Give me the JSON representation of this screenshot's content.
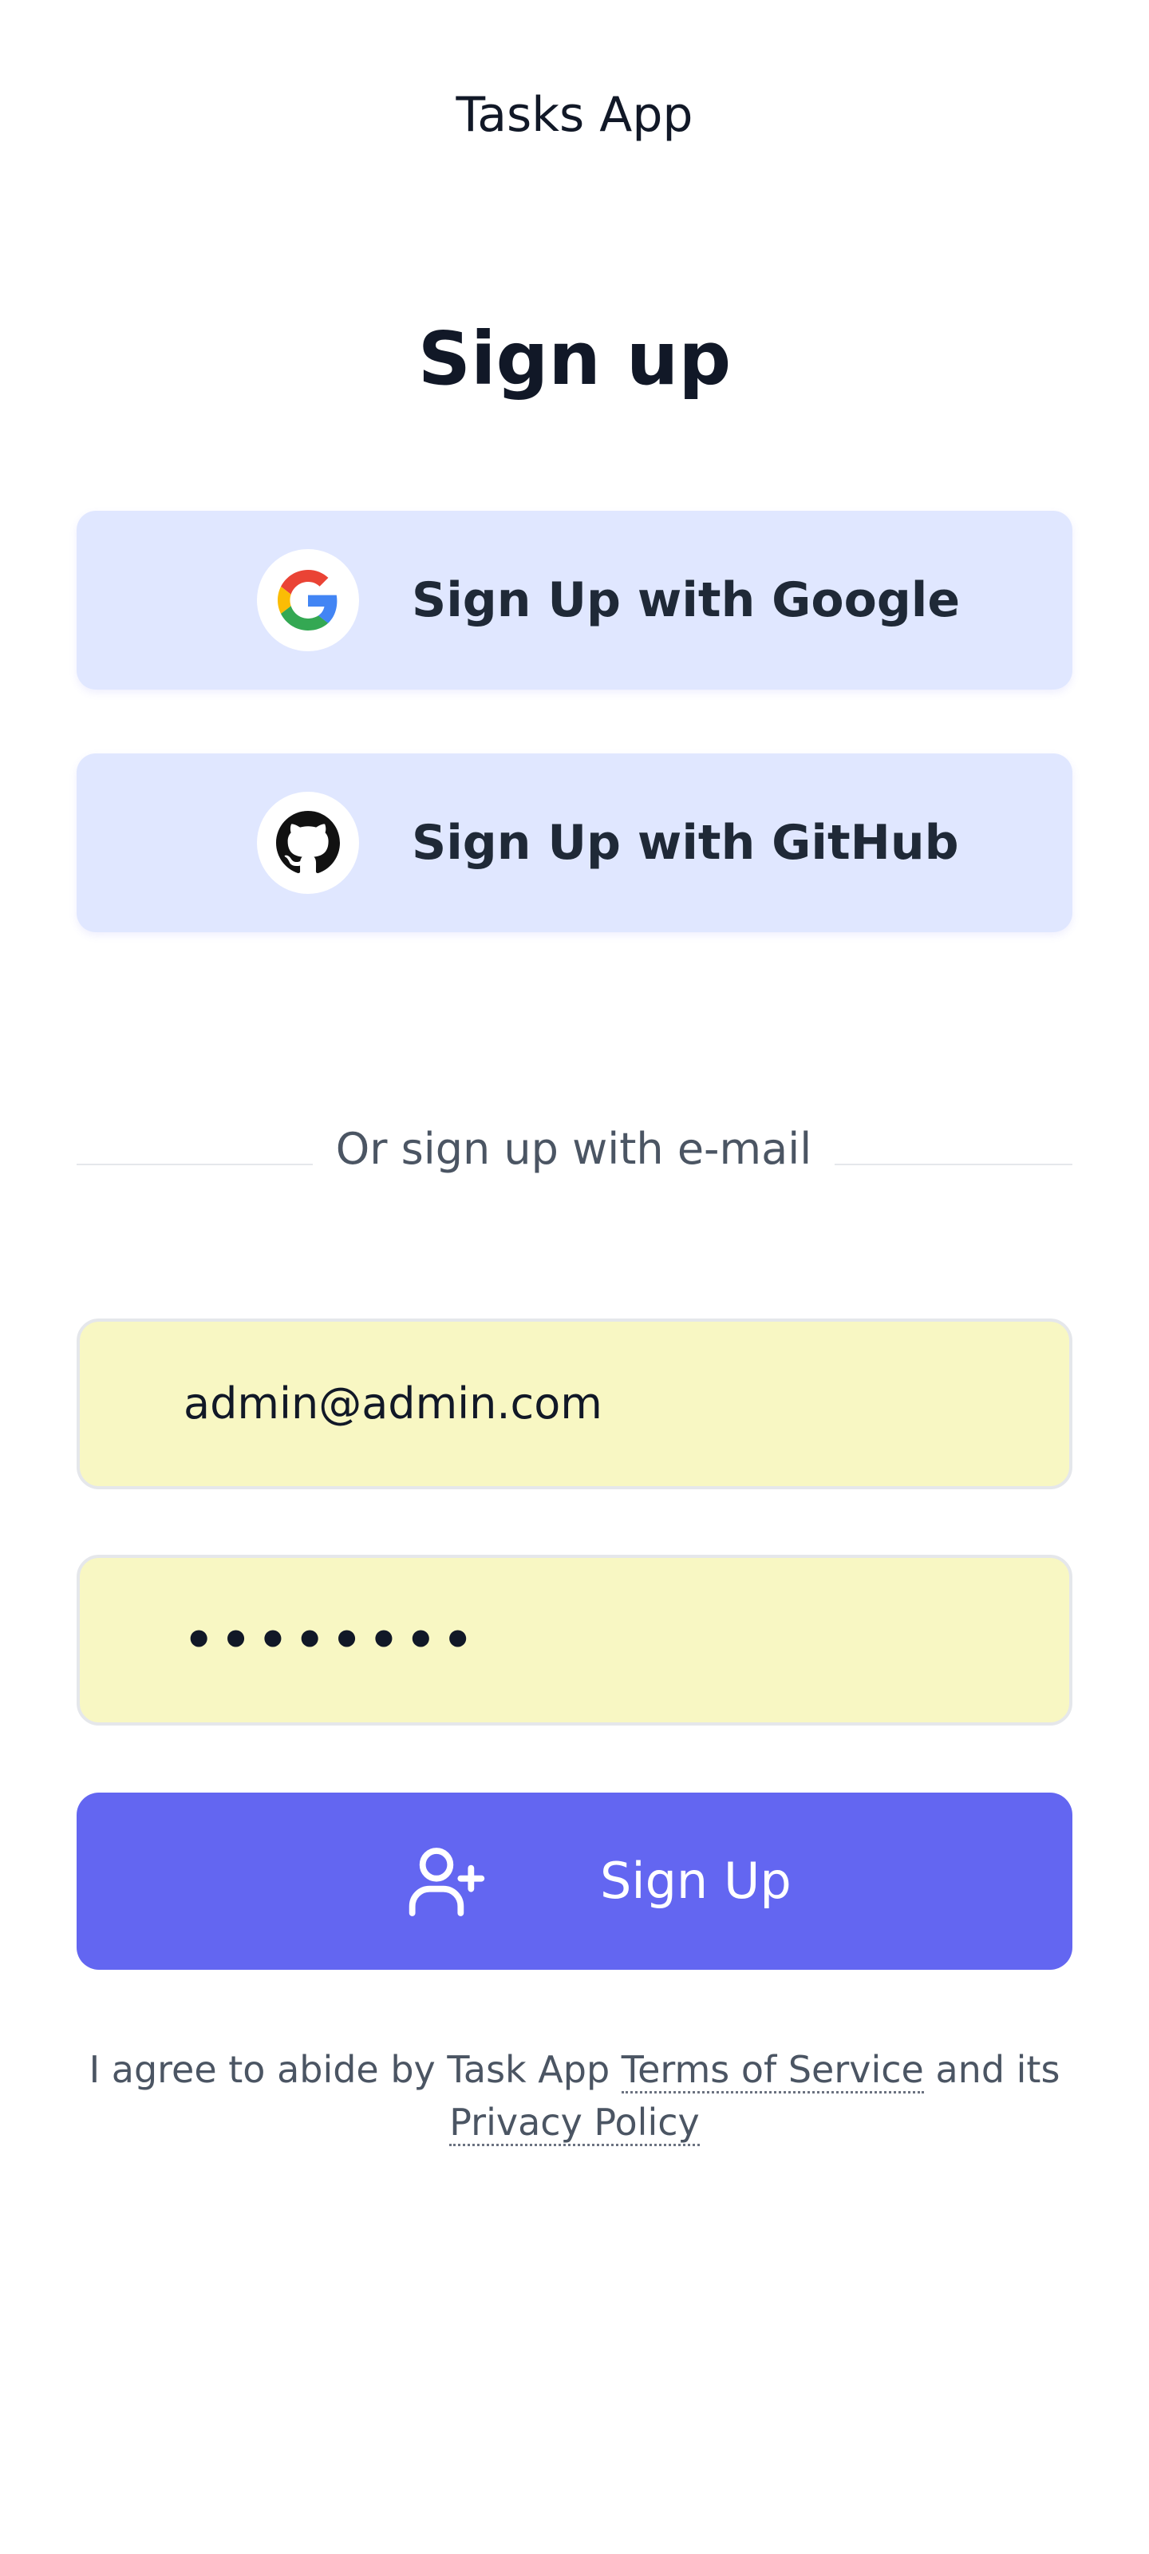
{
  "header": {
    "app_title": "Tasks App"
  },
  "main": {
    "title": "Sign up",
    "oauth": {
      "google_label": "Sign Up with Google",
      "google_icon": "google-icon",
      "github_label": "Sign Up with GitHub",
      "github_icon": "github-icon"
    },
    "divider_text": "Or sign up with e-mail",
    "form": {
      "email_value": "admin@admin.com",
      "password_value": "••••••••",
      "field_background": "#f8f7c3",
      "submit_label": "Sign Up",
      "submit_icon": "user-plus-icon",
      "submit_color": "#6366f1"
    },
    "terms": {
      "prefix": "I agree to abide by Task App",
      "terms_link": "Terms of Service",
      "middle": "and its",
      "privacy_link": "Privacy Policy"
    }
  },
  "colors": {
    "oauth_button_bg": "#e0e7ff",
    "text_primary": "#111827",
    "text_secondary": "#4b5563"
  }
}
